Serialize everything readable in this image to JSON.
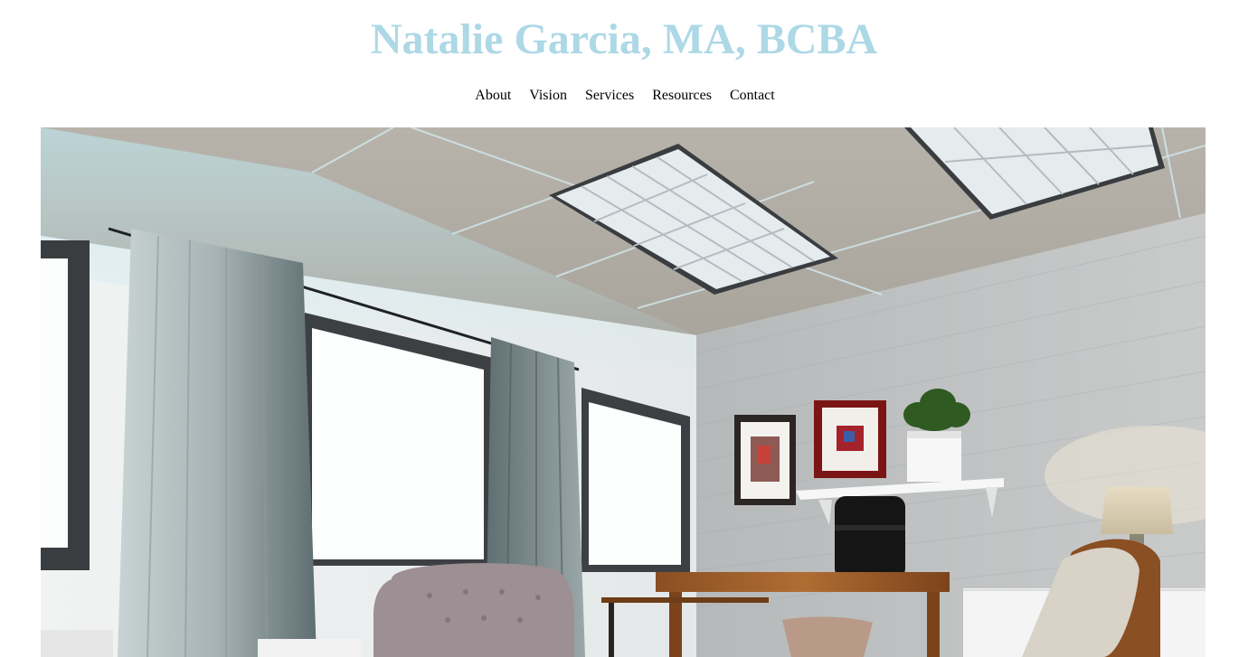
{
  "site": {
    "title": "Natalie Garcia, MA, BCBA",
    "title_color": "#add8e6"
  },
  "nav": {
    "items": [
      {
        "label": "About"
      },
      {
        "label": "Vision"
      },
      {
        "label": "Services"
      },
      {
        "label": "Resources"
      },
      {
        "label": "Contact"
      }
    ]
  },
  "hero": {
    "image": "office-interior-photo",
    "accent_color": "#bfe6ee"
  }
}
